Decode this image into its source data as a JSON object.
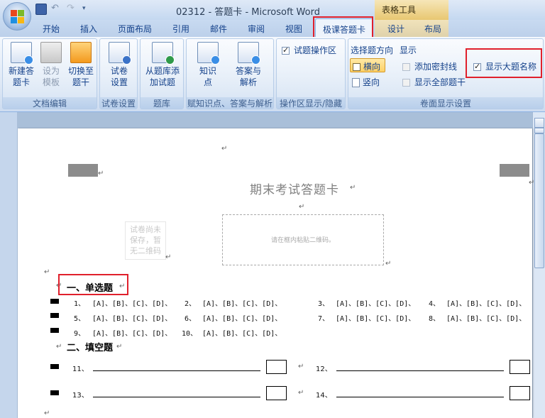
{
  "titlebar": {
    "title": "02312 - 答题卡 - Microsoft Word",
    "context_group": "表格工具"
  },
  "tabs": [
    "开始",
    "插入",
    "页面布局",
    "引用",
    "邮件",
    "审阅",
    "视图",
    "极课答题卡",
    "设计",
    "布局"
  ],
  "ribbon": {
    "group_doc_edit": {
      "label": "文档编辑",
      "new_card": [
        "新建答",
        "题卡"
      ],
      "set_template": [
        "设为",
        "模板"
      ],
      "switch_stem": [
        "切换至",
        "题干"
      ]
    },
    "group_paper": {
      "label": "试卷设置",
      "paper_settings": [
        "试卷",
        "设置"
      ]
    },
    "group_bank": {
      "label": "题库",
      "add_from_bank": [
        "从题库添",
        "加试题"
      ]
    },
    "group_knowledge": {
      "label": "赋知识点、答案与解析",
      "knowledge": [
        "知识",
        "点"
      ],
      "answer": [
        "答案与",
        "解析"
      ]
    },
    "group_area": {
      "label": "操作区显示/隐藏",
      "operation_area": "试题操作区"
    },
    "group_display": {
      "label": "卷面显示设置",
      "direction_title": "选择题方向",
      "horizontal": "横向",
      "vertical": "竖向",
      "display_title": "显示",
      "seal_line": "添加密封线",
      "show_all_stems": "显示全部题干",
      "show_section_names": "显示大题名称"
    }
  },
  "document": {
    "title": "期末考试答题卡",
    "qr_placeholder": "请在框内粘贴二维码。",
    "unsaved_note": [
      "试卷尚未",
      "保存，暂",
      "无二维码"
    ],
    "section1": "一、单选题",
    "section2": "二、填空题",
    "mc_rows": [
      [
        "1、",
        "[A]、[B]、[C]、[D]、",
        "2、",
        "[A]、[B]、[C]、[D]、",
        "3、",
        "[A]、[B]、[C]、[D]、",
        "4、",
        "[A]、[B]、[C]、[D]、"
      ],
      [
        "5、",
        "[A]、[B]、[C]、[D]、",
        "6、",
        "[A]、[B]、[C]、[D]、",
        "7、",
        "[A]、[B]、[C]、[D]、",
        "8、",
        "[A]、[B]、[C]、[D]、"
      ],
      [
        "9、",
        "[A]、[B]、[C]、[D]、",
        "10、",
        "[A]、[B]、[C]、[D]、",
        "",
        "",
        "",
        ""
      ]
    ],
    "fill_numbers": [
      "11、",
      "12、",
      "13、",
      "14、"
    ]
  },
  "colors": {
    "highlight_red": "#e0202c",
    "ribbon_text": "#15428b",
    "tab_accent": "#8db2e3"
  }
}
